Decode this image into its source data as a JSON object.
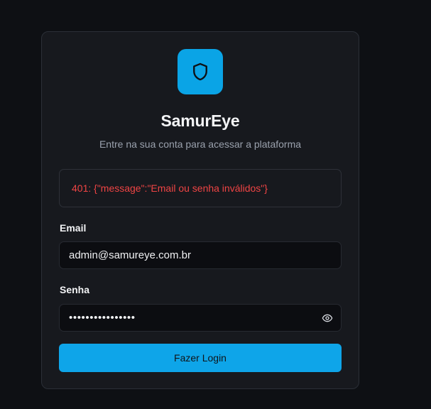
{
  "app": {
    "title": "SamurEye",
    "subtitle": "Entre na sua conta para acessar a plataforma",
    "logo_icon": "shield-icon"
  },
  "error": {
    "message": "401: {\"message\":\"Email ou senha inválidos\"}",
    "color": "#ef4444"
  },
  "form": {
    "email_label": "Email",
    "email_value": "admin@samureye.com.br",
    "password_label": "Senha",
    "password_mask": "••••••••••••••••",
    "password_toggle_icon": "eye-icon",
    "submit_label": "Fazer Login"
  },
  "colors": {
    "accent": "#0ea5e9",
    "background": "#0e1014",
    "card": "#17191e"
  }
}
